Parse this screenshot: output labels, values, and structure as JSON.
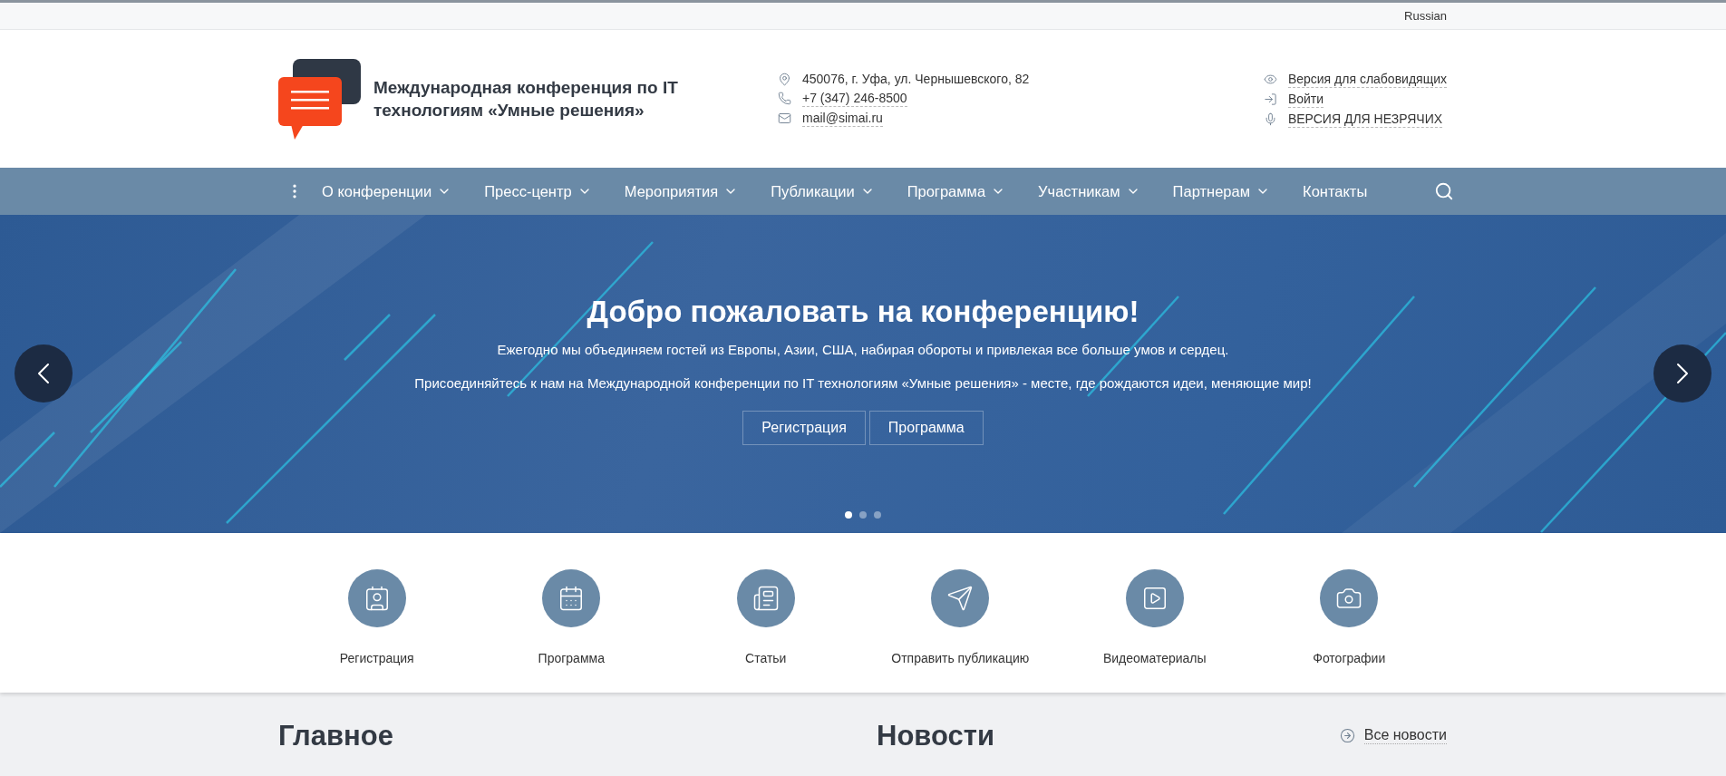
{
  "top_bar": {
    "language": "Russian"
  },
  "header": {
    "title": "Международная конференция по IT технологиям «Умные решения»",
    "contacts": [
      {
        "kind": "address",
        "text": "450076, г. Уфа, ул. Чернышевского, 82"
      },
      {
        "kind": "phone",
        "text": "+7 (347) 246-8500"
      },
      {
        "kind": "email",
        "text": "mail@simai.ru"
      }
    ],
    "links": [
      {
        "kind": "eye",
        "text": "Версия для слабовидящих"
      },
      {
        "kind": "login",
        "text": "Войти"
      },
      {
        "kind": "mic",
        "text": "ВЕРСИЯ ДЛЯ НЕЗРЯЧИХ"
      }
    ]
  },
  "nav": {
    "items": [
      {
        "label": "О конференции",
        "dropdown": true
      },
      {
        "label": "Пресс-центр",
        "dropdown": true
      },
      {
        "label": "Мероприятия",
        "dropdown": true
      },
      {
        "label": "Публикации",
        "dropdown": true
      },
      {
        "label": "Программа",
        "dropdown": true
      },
      {
        "label": "Участникам",
        "dropdown": true
      },
      {
        "label": "Партнерам",
        "dropdown": true
      },
      {
        "label": "Контакты",
        "dropdown": false
      }
    ]
  },
  "hero": {
    "title": "Добро пожаловать на конференцию!",
    "lines": [
      "Ежегодно мы объединяем гостей из Европы, Азии, США, набирая обороты и привлекая все больше умов и сердец.",
      "Присоединяйтесь к нам на Международной конференции по IT технологиям «Умные решения» - месте, где рождаются идеи, меняющие мир!"
    ],
    "buttons": [
      "Регистрация",
      "Программа"
    ],
    "dots": [
      {
        "selected": true
      },
      {
        "selected": false
      },
      {
        "selected": false
      }
    ]
  },
  "quick_links": [
    {
      "kind": "registration",
      "label": "Регистрация"
    },
    {
      "kind": "calendar",
      "label": "Программа"
    },
    {
      "kind": "articles",
      "label": "Статьи"
    },
    {
      "kind": "send",
      "label": "Отправить публикацию"
    },
    {
      "kind": "video",
      "label": "Видеоматериалы"
    },
    {
      "kind": "photo",
      "label": "Фотографии"
    }
  ],
  "sections": {
    "main_title": "Главное",
    "news_title": "Новости",
    "all_news": "Все новости"
  }
}
